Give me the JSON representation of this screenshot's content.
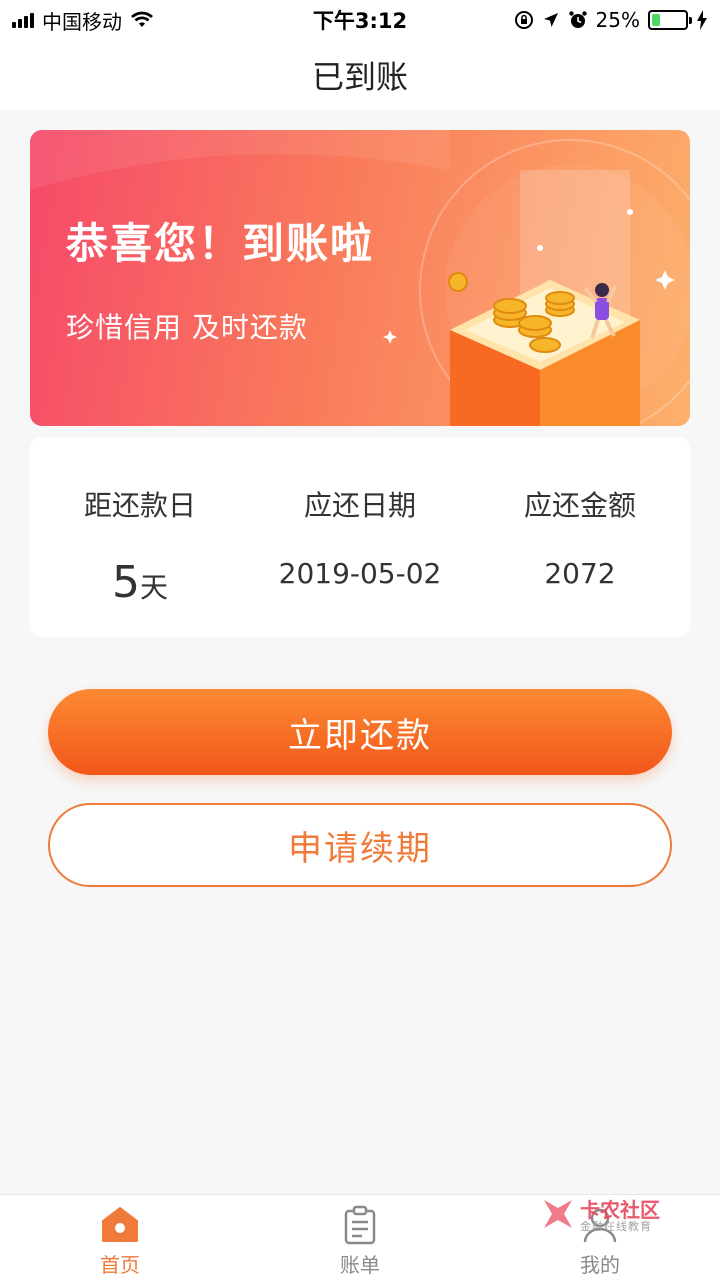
{
  "status_bar": {
    "carrier": "中国移动",
    "time": "下午3:12",
    "battery_percent": "25%",
    "battery_level": 0.25
  },
  "header": {
    "title": "已到账"
  },
  "banner": {
    "title": "恭喜您！到账啦",
    "subtitle": "珍惜信用  及时还款"
  },
  "repayment_info": {
    "columns": [
      {
        "label": "距还款日",
        "value_number": "5",
        "value_unit": "天"
      },
      {
        "label": "应还日期",
        "value": "2019-05-02"
      },
      {
        "label": "应还金额",
        "value": "2072"
      }
    ]
  },
  "actions": {
    "repay_label": "立即还款",
    "renew_label": "申请续期"
  },
  "tab_bar": {
    "items": [
      {
        "label": "首页",
        "icon": "home-icon",
        "active": true
      },
      {
        "label": "账单",
        "icon": "bill-icon",
        "active": false
      },
      {
        "label": "我的",
        "icon": "profile-icon",
        "active": false
      }
    ]
  },
  "watermark": {
    "brand": "卡农社区",
    "tagline": "金融在线教育"
  },
  "colors": {
    "accent": "#f07a3a",
    "banner_start": "#f6496a",
    "banner_end": "#fdb06a"
  }
}
